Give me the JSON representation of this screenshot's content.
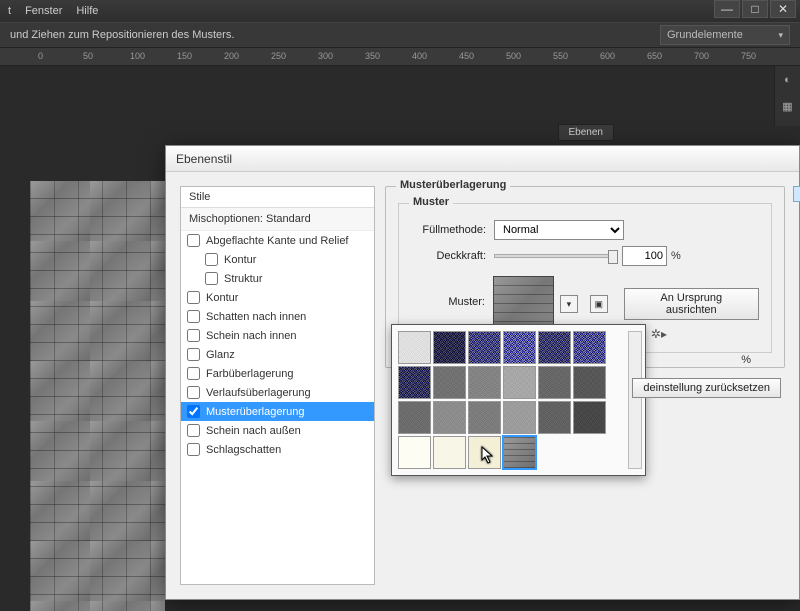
{
  "menubar": {
    "items": [
      "t",
      "Fenster",
      "Hilfe"
    ]
  },
  "hint_bar": {
    "text": "und Ziehen zum Repositionieren des Musters.",
    "preset_dropdown": "Grundelemente"
  },
  "ruler": {
    "ticks": [
      "0",
      "50",
      "100",
      "150",
      "200",
      "250",
      "300",
      "350",
      "400",
      "450",
      "500",
      "550",
      "600",
      "650",
      "700",
      "750"
    ]
  },
  "panel": {
    "tab": "Ebenen"
  },
  "dialog": {
    "title": "Ebenenstil",
    "styles_header": "Stile",
    "blend_header": "Mischoptionen: Standard",
    "style_items": [
      {
        "label": "Abgeflachte Kante und Relief",
        "checked": false,
        "indent": false
      },
      {
        "label": "Kontur",
        "checked": false,
        "indent": true
      },
      {
        "label": "Struktur",
        "checked": false,
        "indent": true
      },
      {
        "label": "Kontur",
        "checked": false,
        "indent": false
      },
      {
        "label": "Schatten nach innen",
        "checked": false,
        "indent": false
      },
      {
        "label": "Schein nach innen",
        "checked": false,
        "indent": false
      },
      {
        "label": "Glanz",
        "checked": false,
        "indent": false
      },
      {
        "label": "Farbüberlagerung",
        "checked": false,
        "indent": false
      },
      {
        "label": "Verlaufsüberlagerung",
        "checked": false,
        "indent": false
      },
      {
        "label": "Musterüberlagerung",
        "checked": true,
        "indent": false,
        "selected": true
      },
      {
        "label": "Schein nach außen",
        "checked": false,
        "indent": false
      },
      {
        "label": "Schlagschatten",
        "checked": false,
        "indent": false
      }
    ],
    "group_title": "Musterüberlagerung",
    "inner_title": "Muster",
    "blend_mode_label": "Füllmethode:",
    "blend_mode_value": "Normal",
    "opacity_label": "Deckkraft:",
    "opacity_value": "100",
    "pattern_label": "Muster:",
    "align_button": "An Ursprung ausrichten",
    "percent_stray": "%",
    "reset_button": "deinstellung zurücksetzen"
  }
}
